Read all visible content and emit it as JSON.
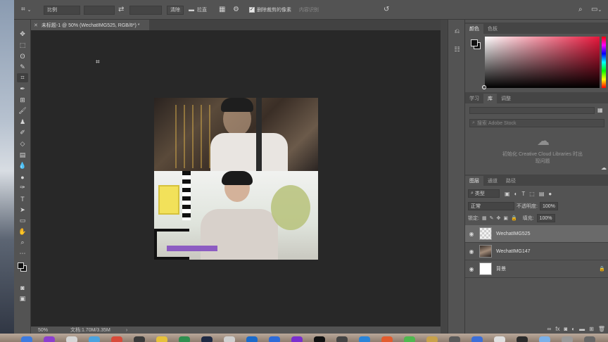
{
  "options_bar": {
    "ratio_select": "比例",
    "clear_button": "清除",
    "straighten_button": "拉直",
    "delete_cropped_label": "删除裁剪的像素",
    "content_aware_label": "内容识别"
  },
  "document": {
    "tab_title": "未标题-1 @ 50% (WechatIMG525, RGB/8*) *"
  },
  "status": {
    "zoom": "50%",
    "doc_size": "文档:1.70M/3.35M"
  },
  "color_panel": {
    "tabs": [
      "颜色",
      "色板"
    ],
    "fg_color": "#111111",
    "bg_color": "#111111"
  },
  "library_panel": {
    "tabs": [
      "学习",
      "库",
      "调整"
    ],
    "search_placeholder": "搜索 Adobe Stock",
    "message_line1": "初始化 Creative Cloud Libraries 时出",
    "message_line2": "现问题"
  },
  "layers_panel": {
    "tabs": [
      "图层",
      "通道",
      "路径"
    ],
    "filter_kind": "类型",
    "blend_mode": "正常",
    "opacity_label": "不透明度:",
    "opacity_value": "100%",
    "lock_label": "锁定:",
    "fill_label": "填充:",
    "fill_value": "100%",
    "layers": [
      {
        "name": "WechatIMG525",
        "selected": true
      },
      {
        "name": "WechatIMG147",
        "selected": false
      },
      {
        "name": "背景",
        "selected": false
      }
    ]
  }
}
